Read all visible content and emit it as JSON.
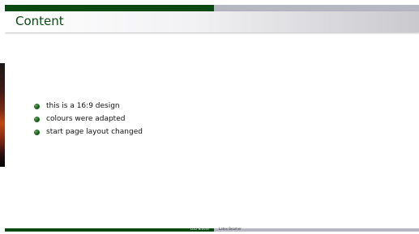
{
  "slide": {
    "title": "Content",
    "bullets": [
      "this is a 16:9 design",
      "colours were adapted",
      "start page layout changed"
    ],
    "footer": {
      "author": "Lutz Brosse",
      "title": "Latex Beamer"
    }
  },
  "colors": {
    "primary_green": "#0a4a12",
    "secondary_gray": "#b7b7c2",
    "bullet": "#1f6a24",
    "text": "#111111"
  },
  "icons": {
    "bullet": "bullet-icon"
  }
}
